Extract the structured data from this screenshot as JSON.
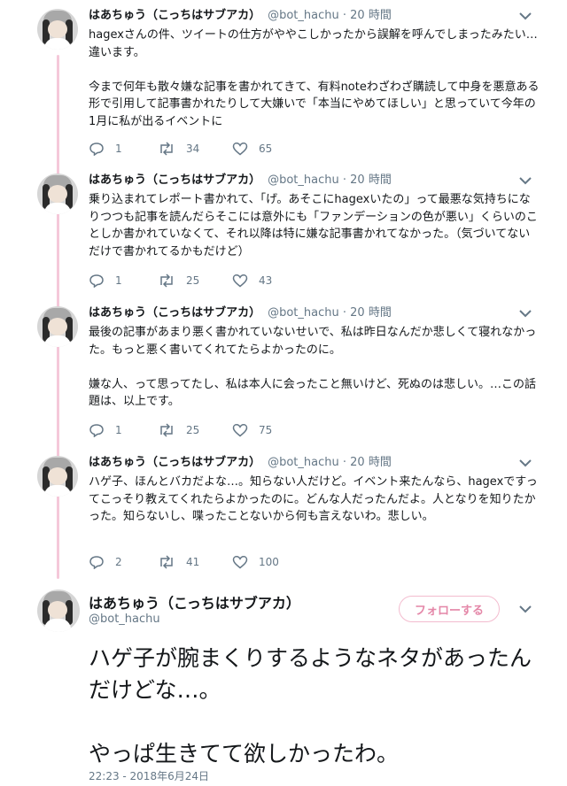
{
  "author": {
    "name": "はあちゅう（こっちはサブアカ）",
    "handle": "@bot_hachu"
  },
  "tweets": [
    {
      "dot": "·",
      "time": "20 時間",
      "text": "hagexさんの件、ツイートの仕方がややこしかったから誤解を呼んでしまったみたい…違います。\n\n今まで何年も散々嫌な記事を書かれてきて、有料noteわざわざ購読して中身を悪意ある形で引用して記事書かれたりして大嫌いで「本当にやめてほしい」と思っていて今年の1月に私が出るイベントに",
      "replies": "1",
      "retweets": "34",
      "likes": "65"
    },
    {
      "dot": "·",
      "time": "20 時間",
      "text": "乗り込まれてレポート書かれて、「げ。あそこにhagexいたの」って最悪な気持ちになりつつも記事を読んだらそこには意外にも「ファンデーションの色が悪い」くらいのことしか書かれていなくて、それ以降は特に嫌な記事書かれてなかった。（気づいてないだけで書かれてるかもだけど）",
      "replies": "1",
      "retweets": "25",
      "likes": "43"
    },
    {
      "dot": "·",
      "time": "20 時間",
      "text": "最後の記事があまり悪く書かれていないせいで、私は昨日なんだか悲しくて寝れなかった。もっと悪く書いてくれてたらよかったのに。\n\n嫌な人、って思ってたし、私は本人に会ったこと無いけど、死ぬのは悲しい。…この話題は、以上です。",
      "replies": "1",
      "retweets": "25",
      "likes": "75"
    },
    {
      "dot": "·",
      "time": "20 時間",
      "text": "ハゲ子、ほんとバカだよな…。知らない人だけど。イベント来たんなら、hagexですってこっそり教えてくれたらよかったのに。どんな人だったんだよ。人となりを知りたかった。知らないし、喋ったことないから何も言えないわ。悲しい。",
      "replies": "2",
      "retweets": "41",
      "likes": "100"
    }
  ],
  "main": {
    "follow_label": "フォローする",
    "text": "ハゲ子が腕まくりするようなネタがあったんだけどな…。\n\nやっぱ生きてて欲しかったわ。",
    "timestamp": "22:23 - 2018年6月24日"
  },
  "colors": {
    "thread_line": "#f5c8d9",
    "follow_border": "#f3bccf",
    "follow_text": "#e487a8",
    "secondary_text": "#657786"
  },
  "icons": [
    "reply-icon",
    "retweet-icon",
    "like-icon",
    "chevron-down-icon"
  ]
}
